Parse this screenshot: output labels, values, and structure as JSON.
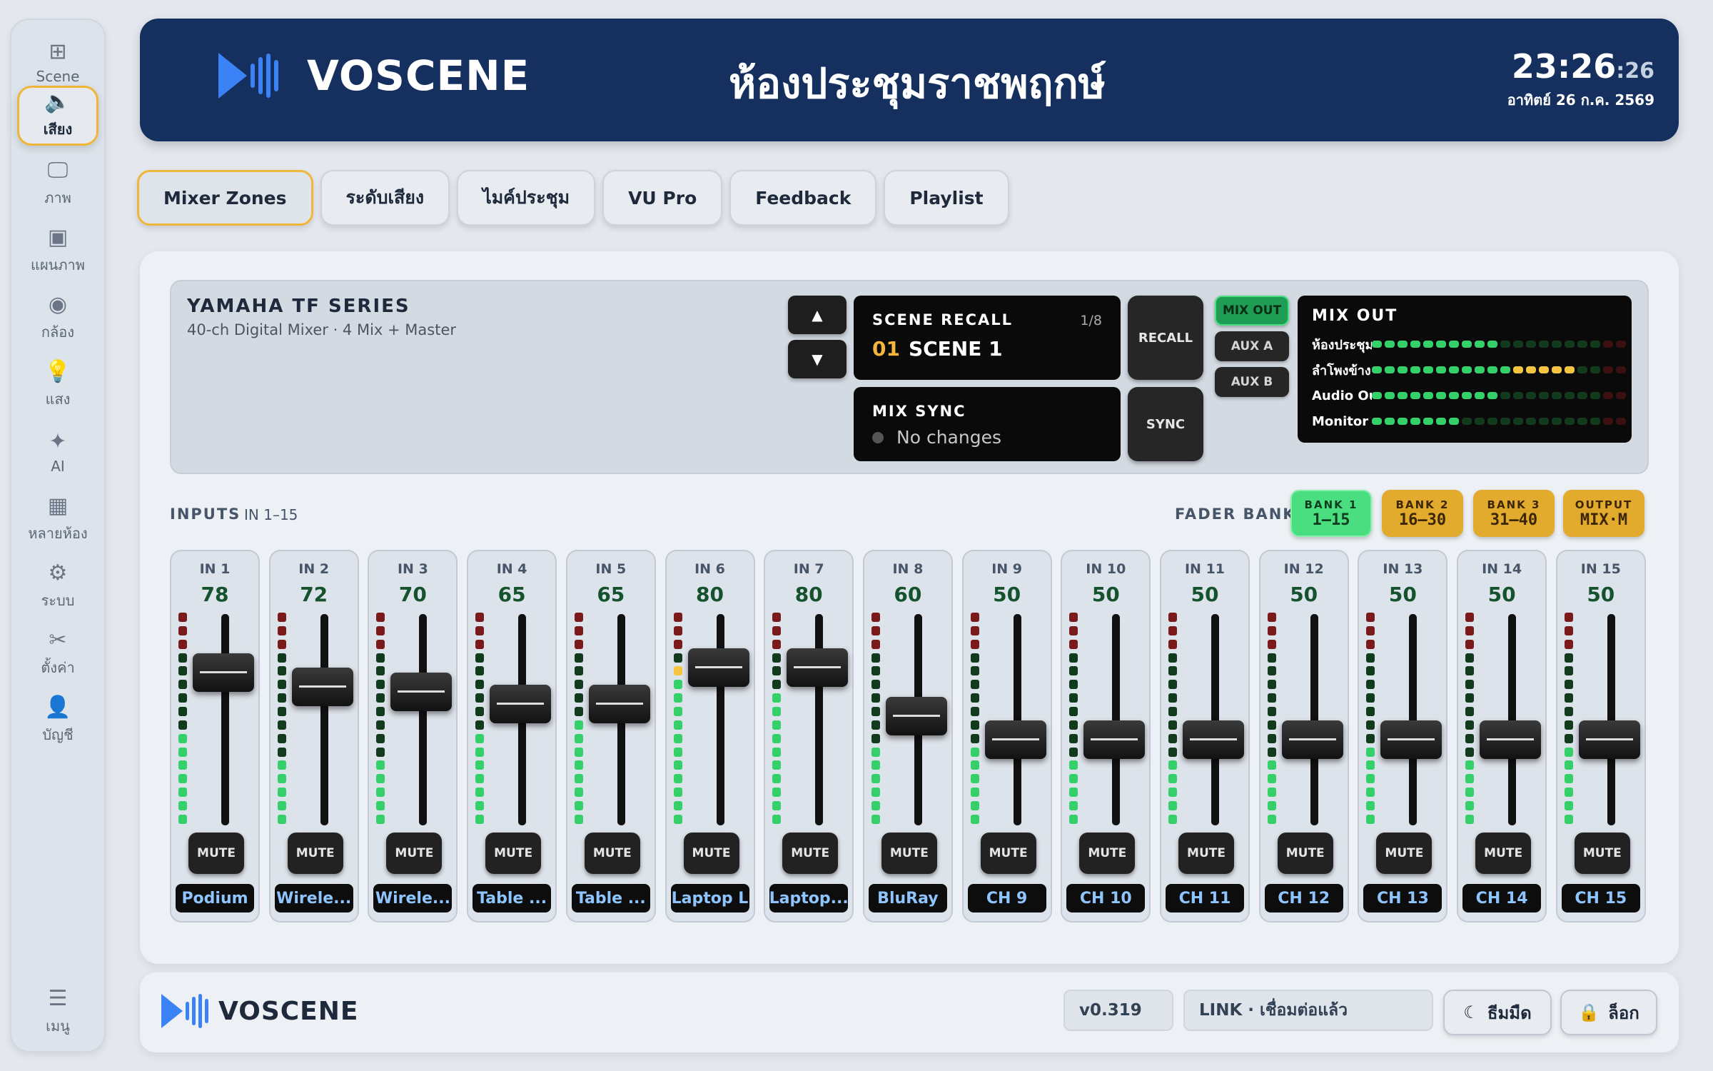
{
  "sidebar": {
    "items": [
      {
        "id": "scene",
        "icon": "grid-icon",
        "glyph": "⊞",
        "label": "Scene",
        "active": false
      },
      {
        "id": "audio",
        "icon": "speaker-icon",
        "glyph": "🔈",
        "label": "เสียง",
        "active": true
      },
      {
        "id": "video",
        "icon": "monitor-icon",
        "glyph": "🖵",
        "label": "ภาพ",
        "active": false
      },
      {
        "id": "layout",
        "icon": "layout-icon",
        "glyph": "▣",
        "label": "แผนภาพ",
        "active": false
      },
      {
        "id": "camera",
        "icon": "webcam-icon",
        "glyph": "◉",
        "label": "กล้อง",
        "active": false
      },
      {
        "id": "light",
        "icon": "bulb-icon",
        "glyph": "💡",
        "label": "แสง",
        "active": false
      },
      {
        "id": "ai",
        "icon": "sparkle-icon",
        "glyph": "✦",
        "label": "AI",
        "active": false
      },
      {
        "id": "rooms",
        "icon": "building-icon",
        "glyph": "▦",
        "label": "หลายห้อง",
        "active": false
      },
      {
        "id": "system",
        "icon": "gear-icon",
        "glyph": "⚙",
        "label": "ระบบ",
        "active": false
      },
      {
        "id": "settings",
        "icon": "tools-icon",
        "glyph": "✂",
        "label": "ตั้งค่า",
        "active": false
      },
      {
        "id": "account",
        "icon": "user-icon",
        "glyph": "👤",
        "label": "บัญชี",
        "active": false
      }
    ],
    "menu": {
      "icon": "menu-icon",
      "glyph": "☰",
      "label": "เมนู"
    }
  },
  "header": {
    "brand": "VOSCENE",
    "room": "ห้องประชุมราชพฤกษ์",
    "time_hm": "23:26",
    "time_s": ":26",
    "date": "อาทิตย์ 26 ก.ค. 2569"
  },
  "tabs": [
    "Mixer Zones",
    "ระดับเสียง",
    "ไมค์ประชุม",
    "VU Pro",
    "Feedback",
    "Playlist"
  ],
  "mixer": {
    "title": "YAMAHA TF SERIES",
    "subtitle": "40-ch Digital Mixer · 4 Mix + Master",
    "scene_recall_label": "SCENE RECALL",
    "scene_count": "1/8",
    "scene_number": "01",
    "scene_name": "SCENE 1",
    "mix_sync_label": "MIX SYNC",
    "mix_sync_status": "No changes",
    "recall_button": "RECALL",
    "sync_button": "SYNC",
    "arrow_up": "▲",
    "arrow_down": "▼",
    "bus_buttons": [
      {
        "label": "MIX OUT",
        "active": true
      },
      {
        "label": "AUX A",
        "active": false
      },
      {
        "label": "AUX B",
        "active": false
      }
    ],
    "mix_out": {
      "title": "MIX OUT",
      "rows": [
        {
          "name": "ห้องประชุม",
          "level": 0.5
        },
        {
          "name": "ลำโพงข้าง",
          "level": 0.8
        },
        {
          "name": "Audio Outl...",
          "level": 0.5
        },
        {
          "name": "Monitor",
          "level": 0.35
        }
      ]
    }
  },
  "inputs": {
    "label": "INPUTS",
    "range": "IN 1–15",
    "fader_bank_label": "FADER BANK",
    "banks": [
      {
        "label": "BANK 1",
        "value": "1–15",
        "bg": "#4ade80",
        "fg": "#0f3d1e",
        "active": true
      },
      {
        "label": "BANK 2",
        "value": "16–30",
        "bg": "#e3ab2d",
        "fg": "#3b2705",
        "active": false
      },
      {
        "label": "BANK 3",
        "value": "31–40",
        "bg": "#e3ab2d",
        "fg": "#3b2705",
        "active": false
      },
      {
        "label": "OUTPUT",
        "value": "MIX·M",
        "bg": "#e3ab2d",
        "fg": "#3b2705",
        "active": false
      }
    ],
    "mute_label": "MUTE",
    "channels": [
      {
        "id": "IN 1",
        "value": "78",
        "name": "Podium",
        "fader": 0.78,
        "meter": 0.45
      },
      {
        "id": "IN 2",
        "value": "72",
        "name": "Wirele...",
        "fader": 0.72,
        "meter": 0.3
      },
      {
        "id": "IN 3",
        "value": "70",
        "name": "Wirele...",
        "fader": 0.7,
        "meter": 0.32
      },
      {
        "id": "IN 4",
        "value": "65",
        "name": "Table ...",
        "fader": 0.65,
        "meter": 0.45
      },
      {
        "id": "IN 5",
        "value": "65",
        "name": "Table ...",
        "fader": 0.65,
        "meter": 0.5
      },
      {
        "id": "IN 6",
        "value": "80",
        "name": "Laptop L",
        "fader": 0.8,
        "meter": 0.72
      },
      {
        "id": "IN 7",
        "value": "80",
        "name": "Laptop...",
        "fader": 0.8,
        "meter": 0.6
      },
      {
        "id": "IN 8",
        "value": "60",
        "name": "BluRay",
        "fader": 0.6,
        "meter": 0.4
      },
      {
        "id": "IN 9",
        "value": "50",
        "name": "CH 9",
        "fader": 0.5,
        "meter": 0.35
      },
      {
        "id": "IN 10",
        "value": "50",
        "name": "CH 10",
        "fader": 0.5,
        "meter": 0.3
      },
      {
        "id": "IN 11",
        "value": "50",
        "name": "CH 11",
        "fader": 0.5,
        "meter": 0.32
      },
      {
        "id": "IN 12",
        "value": "50",
        "name": "CH 12",
        "fader": 0.5,
        "meter": 0.3
      },
      {
        "id": "IN 13",
        "value": "50",
        "name": "CH 13",
        "fader": 0.5,
        "meter": 0.36
      },
      {
        "id": "IN 14",
        "value": "50",
        "name": "CH 14",
        "fader": 0.5,
        "meter": 0.34
      },
      {
        "id": "IN 15",
        "value": "50",
        "name": "CH 15",
        "fader": 0.5,
        "meter": 0.36
      }
    ]
  },
  "footer": {
    "brand": "VOSCENE",
    "version": "v0.319",
    "link_status": "LINK · เชื่อมต่อแล้ว",
    "theme_button": "ธีมมืด",
    "theme_icon": "moon-icon",
    "lock_button": "ล็อก",
    "lock_icon": "lock-icon"
  },
  "colors": {
    "accent": "#f0b63a",
    "header_bg": "#15305f",
    "led_green": "#35d06a",
    "led_yellow": "#f5c542",
    "led_red": "#7a1a1a",
    "led_off": "#123a1c"
  }
}
